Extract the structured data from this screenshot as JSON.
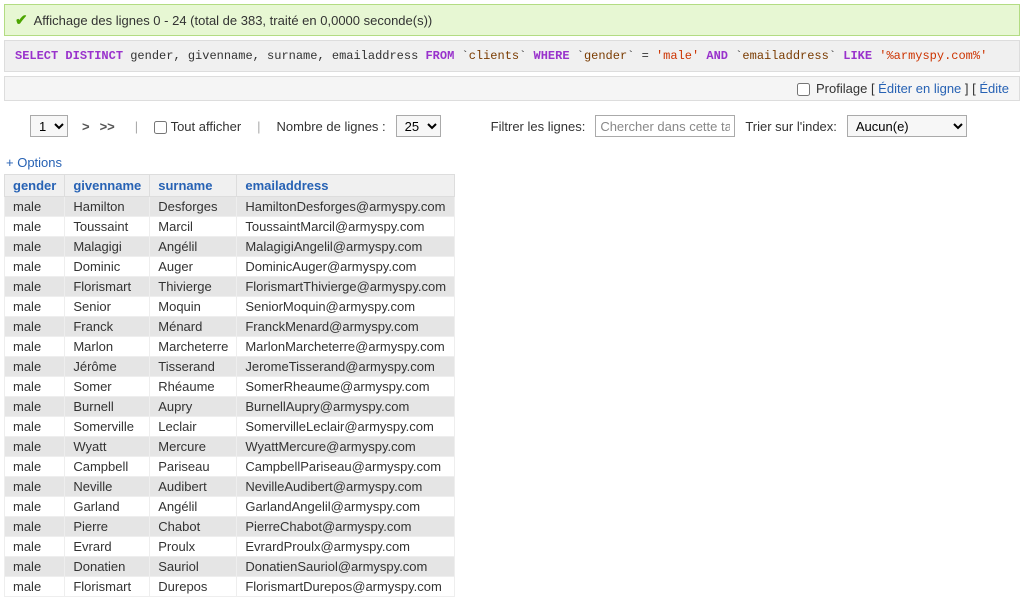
{
  "success_msg": "Affichage des lignes 0 - 24 (total de 383, traité en 0,0000 seconde(s))",
  "sql": {
    "select": "SELECT",
    "distinct": "DISTINCT",
    "cols": " gender, givenname, surname, emailaddress ",
    "from": "FROM",
    "t_open": " `",
    "table": "clients",
    "t_close": "` ",
    "where": "WHERE",
    "g_open": " `",
    "gender": "gender",
    "g_close": "` ",
    "eq": "= ",
    "male": "'male'",
    "and": " AND ",
    "e_open": "`",
    "email": "emailaddress",
    "e_close": "` ",
    "like": "LIKE",
    "pattern": " '%armyspy.com%'"
  },
  "tools": {
    "profilage": "Profilage",
    "edit_inline": "Éditer en ligne",
    "edit": "Édite"
  },
  "nav": {
    "page_value": "1",
    "next": ">",
    "last": ">>",
    "show_all": "Tout afficher",
    "rows_label": "Nombre de lignes :",
    "rows_value": "25",
    "filter_label": "Filtrer les lignes:",
    "filter_placeholder": "Chercher dans cette tab",
    "sort_label": "Trier sur l'index:",
    "sort_value": "Aucun(e)"
  },
  "options_link": "+ Options",
  "columns": [
    "gender",
    "givenname",
    "surname",
    "emailaddress"
  ],
  "rows": [
    [
      "male",
      "Hamilton",
      "Desforges",
      "HamiltonDesforges@armyspy.com"
    ],
    [
      "male",
      "Toussaint",
      "Marcil",
      "ToussaintMarcil@armyspy.com"
    ],
    [
      "male",
      "Malagigi",
      "Angélil",
      "MalagigiAngelil@armyspy.com"
    ],
    [
      "male",
      "Dominic",
      "Auger",
      "DominicAuger@armyspy.com"
    ],
    [
      "male",
      "Florismart",
      "Thivierge",
      "FlorismartThivierge@armyspy.com"
    ],
    [
      "male",
      "Senior",
      "Moquin",
      "SeniorMoquin@armyspy.com"
    ],
    [
      "male",
      "Franck",
      "Ménard",
      "FranckMenard@armyspy.com"
    ],
    [
      "male",
      "Marlon",
      "Marcheterre",
      "MarlonMarcheterre@armyspy.com"
    ],
    [
      "male",
      "Jérôme",
      "Tisserand",
      "JeromeTisserand@armyspy.com"
    ],
    [
      "male",
      "Somer",
      "Rhéaume",
      "SomerRheaume@armyspy.com"
    ],
    [
      "male",
      "Burnell",
      "Aupry",
      "BurnellAupry@armyspy.com"
    ],
    [
      "male",
      "Somerville",
      "Leclair",
      "SomervilleLeclair@armyspy.com"
    ],
    [
      "male",
      "Wyatt",
      "Mercure",
      "WyattMercure@armyspy.com"
    ],
    [
      "male",
      "Campbell",
      "Pariseau",
      "CampbellPariseau@armyspy.com"
    ],
    [
      "male",
      "Neville",
      "Audibert",
      "NevilleAudibert@armyspy.com"
    ],
    [
      "male",
      "Garland",
      "Angélil",
      "GarlandAngelil@armyspy.com"
    ],
    [
      "male",
      "Pierre",
      "Chabot",
      "PierreChabot@armyspy.com"
    ],
    [
      "male",
      "Evrard",
      "Proulx",
      "EvrardProulx@armyspy.com"
    ],
    [
      "male",
      "Donatien",
      "Sauriol",
      "DonatienSauriol@armyspy.com"
    ],
    [
      "male",
      "Florismart",
      "Durepos",
      "FlorismartDurepos@armyspy.com"
    ]
  ]
}
